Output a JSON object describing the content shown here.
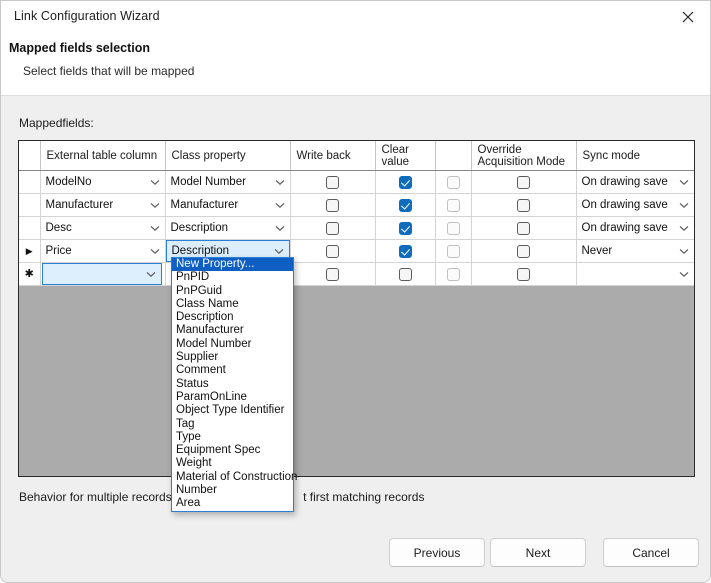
{
  "window": {
    "title": "Link Configuration Wizard",
    "close_icon": "close-icon"
  },
  "header": {
    "title": "Mapped fields selection",
    "subtitle": "Select fields that will be mapped"
  },
  "grid": {
    "label": "Mappedfields:",
    "columns": [
      {
        "key": "selector",
        "label": ""
      },
      {
        "key": "external_table_column",
        "label": "External table column"
      },
      {
        "key": "class_property",
        "label": "Class property"
      },
      {
        "key": "write_back",
        "label": "Write back"
      },
      {
        "key": "clear_value",
        "label": "Clear\nvalue"
      },
      {
        "key": "unnamed",
        "label": ""
      },
      {
        "key": "override_acquisition_mode",
        "label": "Override\nAcquisition Mode"
      },
      {
        "key": "sync_mode",
        "label": "Sync mode"
      }
    ],
    "column_headers": {
      "external_table_column": "External table column",
      "class_property": "Class property",
      "write_back": "Write back",
      "clear_value_line1": "Clear",
      "clear_value_line2": "value",
      "override_line1": "Override",
      "override_line2": "Acquisition Mode",
      "sync_mode": "Sync mode"
    },
    "rows": [
      {
        "marker": "",
        "external_table_column": "ModelNo",
        "class_property": "Model Number",
        "write_back": false,
        "clear_value": true,
        "unnamed": false,
        "override_acquisition_mode": false,
        "sync_mode": "On drawing save",
        "state": "normal"
      },
      {
        "marker": "",
        "external_table_column": "Manufacturer",
        "class_property": "Manufacturer",
        "write_back": false,
        "clear_value": true,
        "unnamed": false,
        "override_acquisition_mode": false,
        "sync_mode": "On drawing save",
        "state": "normal"
      },
      {
        "marker": "",
        "external_table_column": "Desc",
        "class_property": "Description",
        "write_back": false,
        "clear_value": true,
        "unnamed": false,
        "override_acquisition_mode": false,
        "sync_mode": "On drawing save",
        "state": "normal"
      },
      {
        "marker": "▶",
        "external_table_column": "Price",
        "class_property": "Description",
        "write_back": false,
        "clear_value": true,
        "unnamed": false,
        "override_acquisition_mode": false,
        "sync_mode": "Never",
        "state": "current"
      },
      {
        "marker": "✱",
        "external_table_column": "",
        "class_property": "",
        "write_back": false,
        "clear_value": false,
        "unnamed": false,
        "override_acquisition_mode": false,
        "sync_mode": "",
        "state": "new"
      }
    ]
  },
  "dropdown": {
    "open": true,
    "owner": "class-property-row-4",
    "selected": "New Property...",
    "items": [
      "New Property...",
      "PnPID",
      "PnPGuid",
      "Class Name",
      "Description",
      "Manufacturer",
      "Model Number",
      "Supplier",
      "Comment",
      "Status",
      "ParamOnLine",
      "Object Type Identifier",
      "Tag",
      "Type",
      "Equipment Spec",
      "Weight",
      "Material of Construction",
      "Number",
      "Area"
    ]
  },
  "status": {
    "text_before": "Behavior for multiple records",
    "text_after": "t first matching records"
  },
  "footer": {
    "previous_label": "Previous",
    "next_label": "Next",
    "cancel_label": "Cancel"
  },
  "colors": {
    "accent": "#0f6cbd",
    "selection": "#0f5ec4",
    "active_cell": "#cfe7f9",
    "grid_filler": "#ababab",
    "dialog_bg": "#efefef"
  }
}
